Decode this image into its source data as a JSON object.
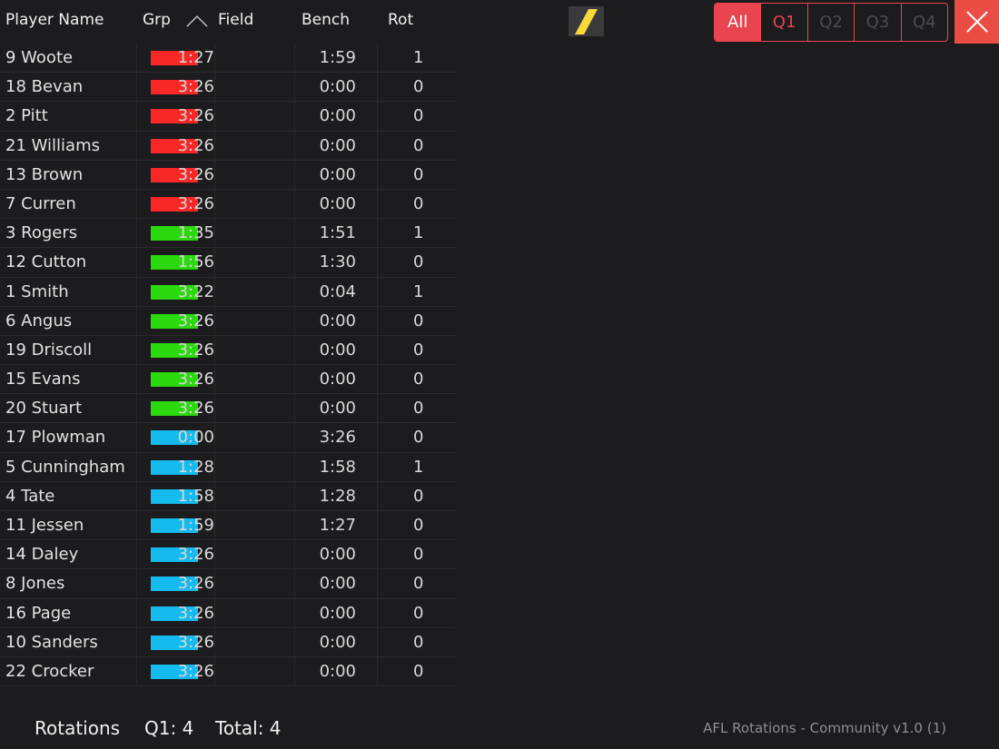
{
  "header": {
    "col_name": "Player Name",
    "col_grp": "Grp",
    "col_field": "Field",
    "col_bench": "Bench",
    "col_rot": "Rot",
    "sort_icon": "chevron-up-icon",
    "logo_icon": "slash-logo-icon"
  },
  "filters": {
    "all": "All",
    "q1": "Q1",
    "q2": "Q2",
    "q3": "Q3",
    "q4": "Q4",
    "selected": "All"
  },
  "close_icon": "close-icon",
  "colors": {
    "red": "#fa2727",
    "green": "#2cd80e",
    "blue": "#15baef",
    "accent": "#e8454f"
  },
  "players": [
    {
      "name": "9 Woote",
      "group": "red",
      "field": "1:27",
      "bench": "1:59",
      "rot": "1"
    },
    {
      "name": "18 Bevan",
      "group": "red",
      "field": "3:26",
      "bench": "0:00",
      "rot": "0"
    },
    {
      "name": "2 Pitt",
      "group": "red",
      "field": "3:26",
      "bench": "0:00",
      "rot": "0"
    },
    {
      "name": "21 Williams",
      "group": "red",
      "field": "3:26",
      "bench": "0:00",
      "rot": "0"
    },
    {
      "name": "13 Brown",
      "group": "red",
      "field": "3:26",
      "bench": "0:00",
      "rot": "0"
    },
    {
      "name": "7 Curren",
      "group": "red",
      "field": "3:26",
      "bench": "0:00",
      "rot": "0"
    },
    {
      "name": "3 Rogers",
      "group": "green",
      "field": "1:35",
      "bench": "1:51",
      "rot": "1"
    },
    {
      "name": "12 Cutton",
      "group": "green",
      "field": "1:56",
      "bench": "1:30",
      "rot": "0"
    },
    {
      "name": "1 Smith",
      "group": "green",
      "field": "3:22",
      "bench": "0:04",
      "rot": "1"
    },
    {
      "name": "6 Angus",
      "group": "green",
      "field": "3:26",
      "bench": "0:00",
      "rot": "0"
    },
    {
      "name": "19 Driscoll",
      "group": "green",
      "field": "3:26",
      "bench": "0:00",
      "rot": "0"
    },
    {
      "name": "15 Evans",
      "group": "green",
      "field": "3:26",
      "bench": "0:00",
      "rot": "0"
    },
    {
      "name": "20 Stuart",
      "group": "green",
      "field": "3:26",
      "bench": "0:00",
      "rot": "0"
    },
    {
      "name": "17 Plowman",
      "group": "blue",
      "field": "0:00",
      "bench": "3:26",
      "rot": "0"
    },
    {
      "name": "5 Cunningham",
      "group": "blue",
      "field": "1:28",
      "bench": "1:58",
      "rot": "1"
    },
    {
      "name": "4 Tate",
      "group": "blue",
      "field": "1:58",
      "bench": "1:28",
      "rot": "0"
    },
    {
      "name": "11 Jessen",
      "group": "blue",
      "field": "1:59",
      "bench": "1:27",
      "rot": "0"
    },
    {
      "name": "14 Daley",
      "group": "blue",
      "field": "3:26",
      "bench": "0:00",
      "rot": "0"
    },
    {
      "name": "8 Jones",
      "group": "blue",
      "field": "3:26",
      "bench": "0:00",
      "rot": "0"
    },
    {
      "name": "16 Page",
      "group": "blue",
      "field": "3:26",
      "bench": "0:00",
      "rot": "0"
    },
    {
      "name": "10 Sanders",
      "group": "blue",
      "field": "3:26",
      "bench": "0:00",
      "rot": "0"
    },
    {
      "name": "22 Crocker",
      "group": "blue",
      "field": "3:26",
      "bench": "0:00",
      "rot": "0"
    }
  ],
  "footer": {
    "rotations_label": "Rotations",
    "q1_rotations": "Q1: 4",
    "total_rotations": "Total: 4",
    "version": "AFL Rotations - Community v1.0 (1)"
  }
}
